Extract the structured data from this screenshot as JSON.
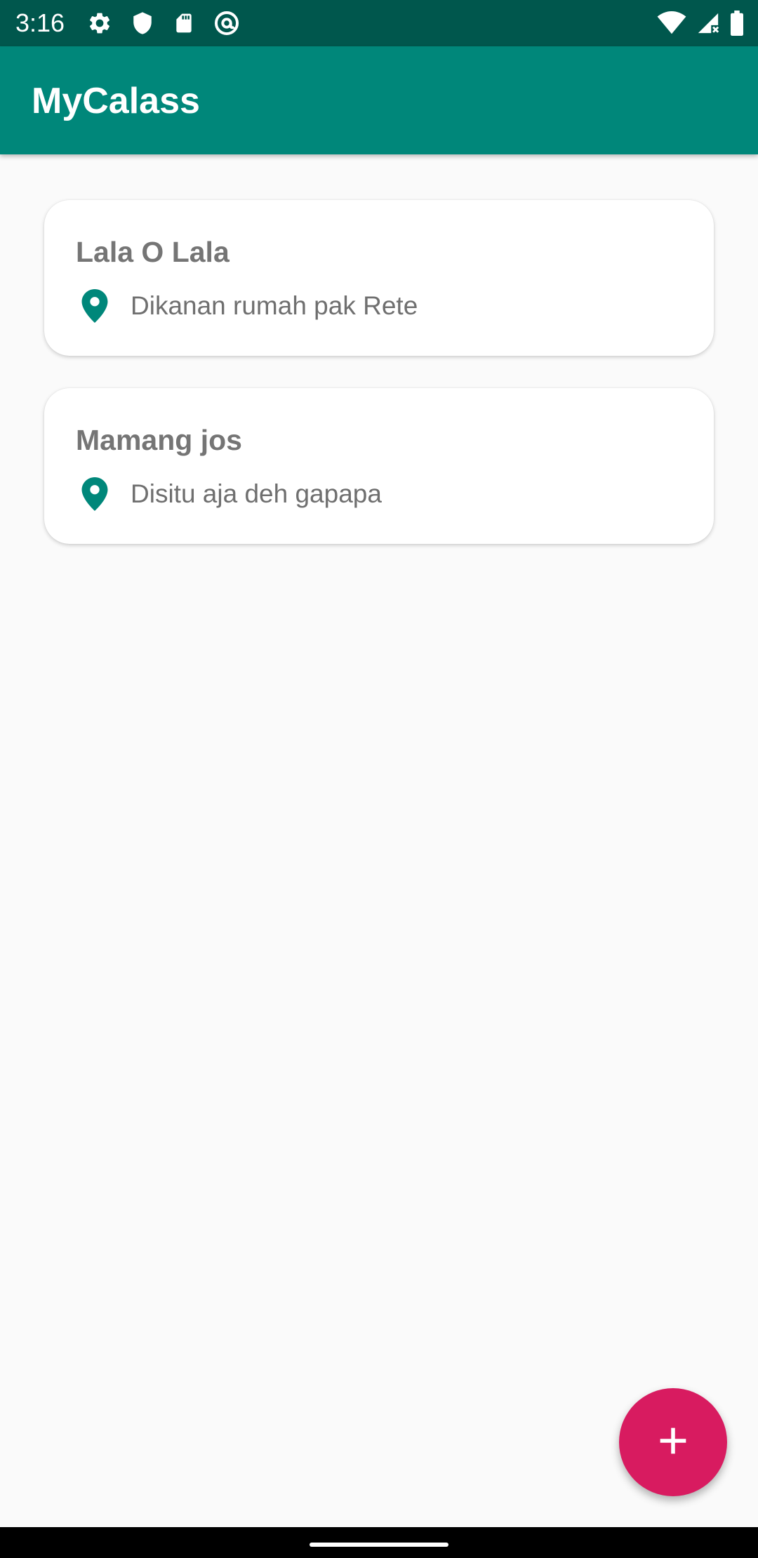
{
  "status_bar": {
    "time": "3:16",
    "left_icons": [
      "gear-icon",
      "shield-icon",
      "sd-card-icon",
      "at-sign-icon"
    ],
    "right_icons": [
      "wifi-icon",
      "cell-signal-icon",
      "battery-icon"
    ]
  },
  "app_bar": {
    "title": "MyCalass"
  },
  "items": [
    {
      "title": "Lala O Lala",
      "address": "Dikanan rumah pak Rete",
      "icon": "location-pin-icon"
    },
    {
      "title": "Mamang jos",
      "address": "Disitu aja deh gapapa",
      "icon": "location-pin-icon"
    }
  ],
  "fab": {
    "icon": "plus-icon"
  },
  "colors": {
    "status_bar": "#00574d",
    "primary": "#00877a",
    "accent": "#d81b60",
    "background": "#fafafa"
  }
}
